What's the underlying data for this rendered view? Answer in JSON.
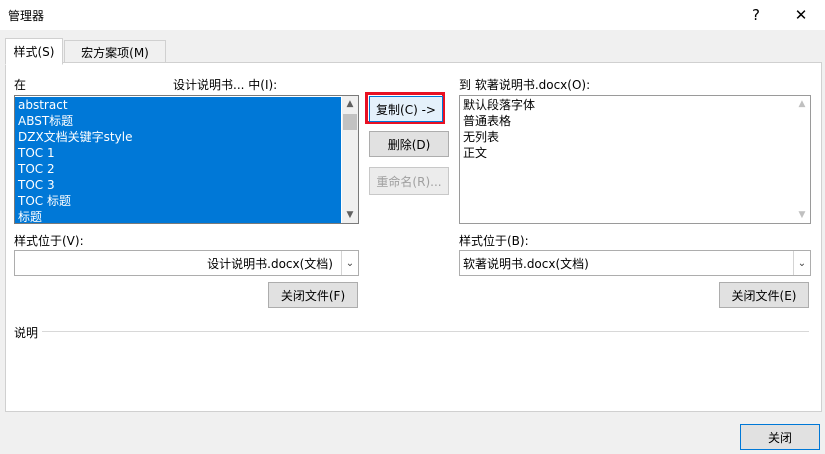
{
  "window": {
    "title": "管理器",
    "help_label": "?",
    "close_label": "✕"
  },
  "tabs": [
    {
      "label": "样式(S)"
    },
    {
      "label": "宏方案项(M)"
    }
  ],
  "left": {
    "in_label": "在",
    "doc_label": "设计说明书... 中(I):",
    "items": [
      "abstract",
      "ABST标题",
      "DZX文档关键字style",
      "TOC 1",
      "TOC 2",
      "TOC 3",
      "TOC 标题",
      "标题"
    ],
    "location_label": "样式位于(V):",
    "location_value": "设计说明书.docx(文档)",
    "close_file_label": "关闭文件(F)"
  },
  "right": {
    "to_label": "到 软著说明书.docx(O):",
    "items": [
      "默认段落字体",
      "普通表格",
      "无列表",
      "正文"
    ],
    "location_label": "样式位于(B):",
    "location_value": "软著说明书.docx(文档)",
    "close_file_label": "关闭文件(E)"
  },
  "actions": {
    "copy_label": "复制(C) ->",
    "delete_label": "删除(D)",
    "rename_label": "重命名(R)..."
  },
  "description": {
    "label": "说明"
  },
  "footer": {
    "close_label": "关闭"
  },
  "colors": {
    "selection": "#0078d7",
    "highlight_frame": "#e81123"
  }
}
